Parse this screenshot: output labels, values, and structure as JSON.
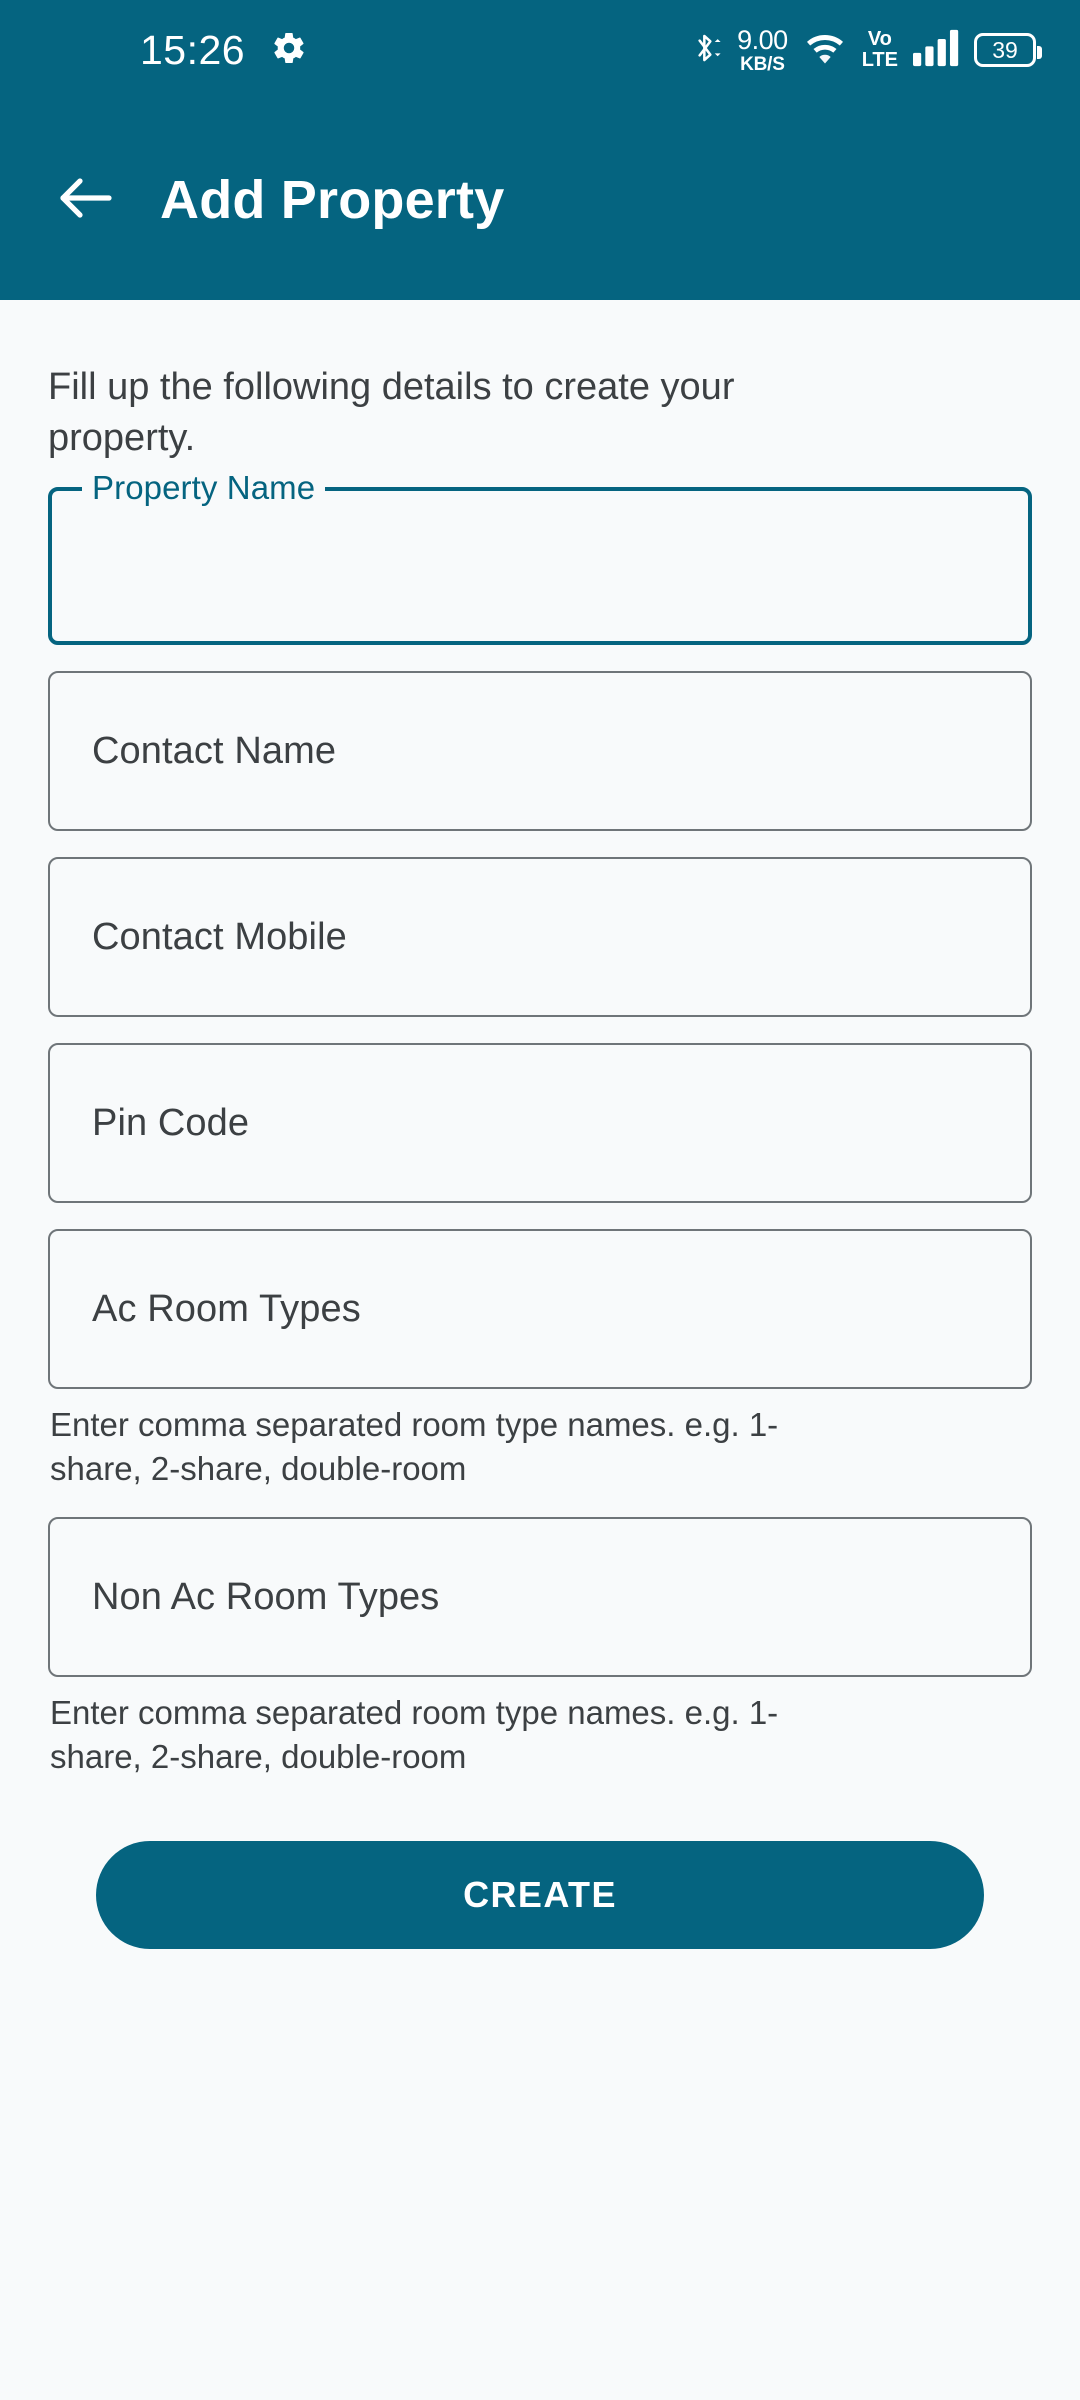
{
  "theme": {
    "primary": "#056480",
    "background": "#f8fafb",
    "text": "#3c4043",
    "border": "#6f7579",
    "on_primary": "#ffffff"
  },
  "status_bar": {
    "time": "15:26",
    "settings_icon": "gear-icon",
    "bluetooth_icon": "bluetooth-icon",
    "net_speed_value": "9.00",
    "net_speed_unit": "KB/S",
    "wifi_icon": "wifi-icon",
    "volte_line1": "Vo",
    "volte_line2": "LTE",
    "signal_icon": "cellular-signal-icon",
    "battery_level": "39"
  },
  "app_bar": {
    "back_icon": "back-arrow-icon",
    "title": "Add Property"
  },
  "main": {
    "intro": "Fill up the following details to create your property.",
    "fields": [
      {
        "name": "property-name",
        "label": "Property Name",
        "value": "",
        "focused": true,
        "helper": ""
      },
      {
        "name": "contact-name",
        "label": "Contact Name",
        "value": "",
        "focused": false,
        "helper": ""
      },
      {
        "name": "contact-mobile",
        "label": "Contact Mobile",
        "value": "",
        "focused": false,
        "helper": ""
      },
      {
        "name": "pin-code",
        "label": "Pin Code",
        "value": "",
        "focused": false,
        "helper": ""
      },
      {
        "name": "ac-room-types",
        "label": "Ac Room Types",
        "value": "",
        "focused": false,
        "helper": "Enter comma separated room type names. e.g. 1-share, 2-share, double-room"
      },
      {
        "name": "non-ac-room-types",
        "label": "Non Ac Room Types",
        "value": "",
        "focused": false,
        "helper": "Enter comma separated room type names. e.g. 1-share, 2-share, double-room"
      }
    ],
    "create_label": "CREATE"
  }
}
